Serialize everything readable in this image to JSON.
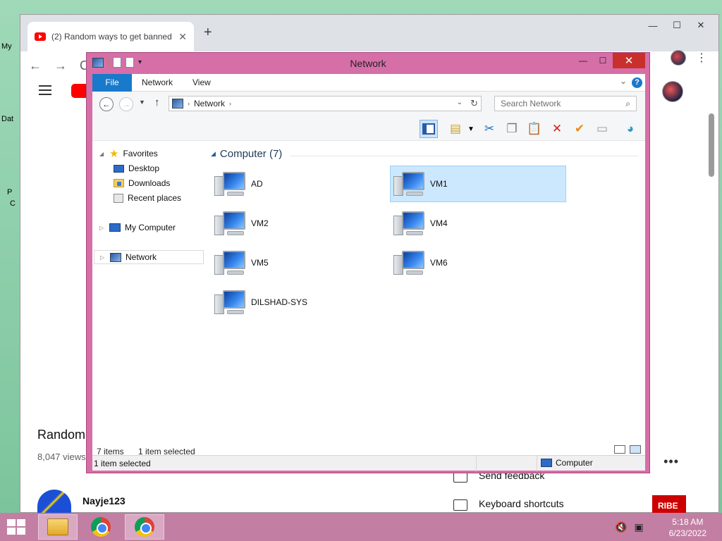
{
  "desktop": {
    "labels": [
      "My",
      "Dat",
      "P",
      "C"
    ]
  },
  "chrome": {
    "tab_title": "(2) Random ways to get banned",
    "tab_close": "✕",
    "new_tab": "+",
    "win_min": "—",
    "win_max": "☐",
    "win_close": "✕",
    "back": "←",
    "forward": "→",
    "reload": "C"
  },
  "youtube": {
    "video_title": "Random",
    "views": "8,047 views",
    "channel": "Nayje123",
    "more": "•••",
    "menu_items": [
      "Send feedback",
      "Keyboard shortcuts"
    ],
    "subscribe": "RIBE"
  },
  "explorer": {
    "title": "Network",
    "win_min": "—",
    "win_max": "☐",
    "win_close": "✕",
    "ribbon_tabs": [
      "File",
      "Network",
      "View"
    ],
    "help": "?",
    "collapse": "⌄",
    "address": {
      "crumb": "Network",
      "separator": "›",
      "dropdown": "⌄",
      "refresh": "↻"
    },
    "search_placeholder": "Search Network",
    "nav_pane": {
      "favorites": "Favorites",
      "desktop": "Desktop",
      "downloads": "Downloads",
      "recent": "Recent places",
      "computer": "My Computer",
      "network": "Network"
    },
    "group_title": "Computer (7)",
    "items": [
      {
        "label": "AD",
        "selected": false
      },
      {
        "label": "VM1",
        "selected": true
      },
      {
        "label": "VM2",
        "selected": false
      },
      {
        "label": "VM4",
        "selected": false
      },
      {
        "label": "VM5",
        "selected": false
      },
      {
        "label": "VM6",
        "selected": false
      },
      {
        "label": "DILSHAD-SYS",
        "selected": false
      }
    ],
    "status": {
      "item_count": "7 items",
      "selected_count": "1 item selected",
      "bar_left": "1 item selected",
      "zone": "Computer"
    },
    "toolbar_icons": [
      "layout-icon",
      "properties-icon",
      "cut-icon",
      "copy-icon",
      "paste-icon",
      "delete-icon",
      "check-icon",
      "rename-icon",
      "globe-icon"
    ]
  },
  "taskbar": {
    "time": "5:18 AM",
    "date": "6/23/2022"
  },
  "colors": {
    "explorer_frame": "#d66ea8",
    "taskbar": "#c27fa3",
    "selection": "#cce8ff",
    "file_tab": "#1979ca"
  }
}
